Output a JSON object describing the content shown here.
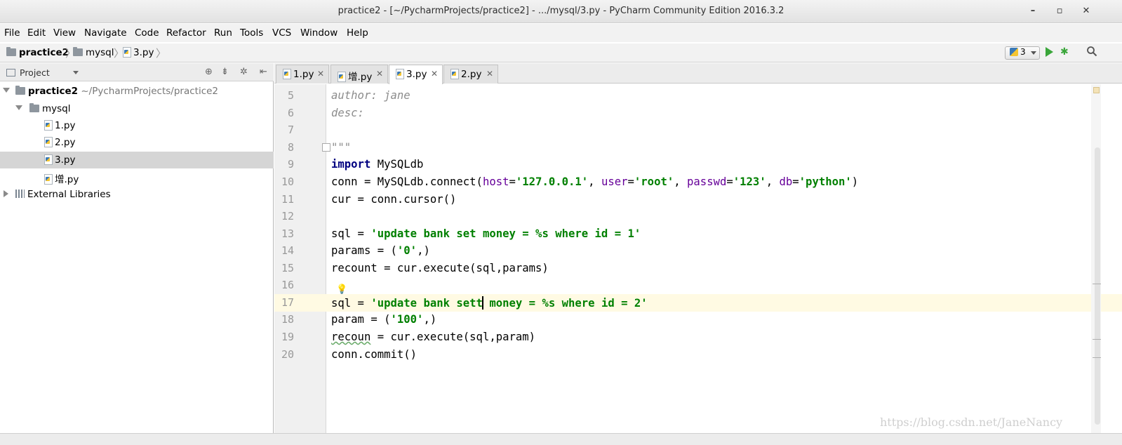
{
  "window": {
    "title": "practice2 - [~/PycharmProjects/practice2] - .../mysql/3.py - PyCharm Community Edition 2016.3.2",
    "minimize": "–",
    "maximize": "▫",
    "close": "✕"
  },
  "menu": [
    {
      "label": "File"
    },
    {
      "label": "Edit"
    },
    {
      "label": "View"
    },
    {
      "label": "Navigate"
    },
    {
      "label": "Code"
    },
    {
      "label": "Refactor"
    },
    {
      "label": "Run"
    },
    {
      "label": "Tools"
    },
    {
      "label": "VCS"
    },
    {
      "label": "Window"
    },
    {
      "label": "Help"
    }
  ],
  "breadcrumb": [
    {
      "label": "practice2",
      "icon": "folder-icon"
    },
    {
      "label": "mysql",
      "icon": "folder-icon"
    },
    {
      "label": "3.py",
      "icon": "python-file-icon"
    }
  ],
  "toolbar": {
    "run_config": "3",
    "icons": [
      "python-icon",
      "run-icon",
      "debug-icon",
      "search-icon"
    ],
    "accent_run": "#3aa63a"
  },
  "project_panel": {
    "title": "Project",
    "tree": [
      {
        "label": "practice2",
        "path": "~/PycharmProjects/practice2",
        "type": "project-root",
        "expanded": true
      },
      {
        "label": "mysql",
        "type": "folder",
        "expanded": true
      },
      {
        "label": "1.py",
        "type": "file"
      },
      {
        "label": "2.py",
        "type": "file"
      },
      {
        "label": "3.py",
        "type": "file",
        "selected": true
      },
      {
        "label": "增.py",
        "type": "file"
      },
      {
        "label": "External Libraries",
        "type": "libraries",
        "expanded": false
      }
    ]
  },
  "tabs": [
    {
      "label": "1.py",
      "active": false
    },
    {
      "label": "增.py",
      "active": false
    },
    {
      "label": "3.py",
      "active": true
    },
    {
      "label": "2.py",
      "active": false
    }
  ],
  "tab_close": "✕",
  "editor": {
    "line_numbers": [
      "5",
      "6",
      "7",
      "8",
      "9",
      "10",
      "11",
      "12",
      "13",
      "14",
      "15",
      "16",
      "17",
      "18",
      "19",
      "20"
    ],
    "current_line": "17",
    "code": {
      "l5": "author: jane",
      "l6": "desc:",
      "l8": "\"\"\"",
      "l9_kw": "import",
      "l9_rest": " MySQLdb",
      "l10_a": "conn = MySQLdb.connect(",
      "l10_host": "host",
      "l10_host_v": "'127.0.0.1'",
      "l10_user": "user",
      "l10_user_v": "'root'",
      "l10_pw": "passwd",
      "l10_pw_v": "'123'",
      "l10_db": "db",
      "l10_db_v": "'python'",
      "l11": "cur = conn.cursor()",
      "l13_a": "sql = ",
      "l13_s": "'update bank set money = %s where id = 1'",
      "l14_a": "params = (",
      "l14_s": "'0'",
      "l14_b": ",)",
      "l15": "recount = cur.execute(sql,params)",
      "l17_a": "sql = ",
      "l17_s1": "'update bank sett",
      "l17_s2": " money = %s where id = 2'",
      "l18_a": "param = (",
      "l18_s": "'100'",
      "l18_b": ",)",
      "l19_typo": "recoun",
      "l19_rest": " = cur.execute(sql,param)",
      "l20": "conn.commit()"
    }
  },
  "watermark": "https://blog.csdn.net/JaneNancy",
  "colors": {
    "keyword": "#000080",
    "string": "#008000",
    "comment": "#8c8c8c",
    "kwarg": "#660099",
    "current_line_bg": "#fffae3"
  }
}
